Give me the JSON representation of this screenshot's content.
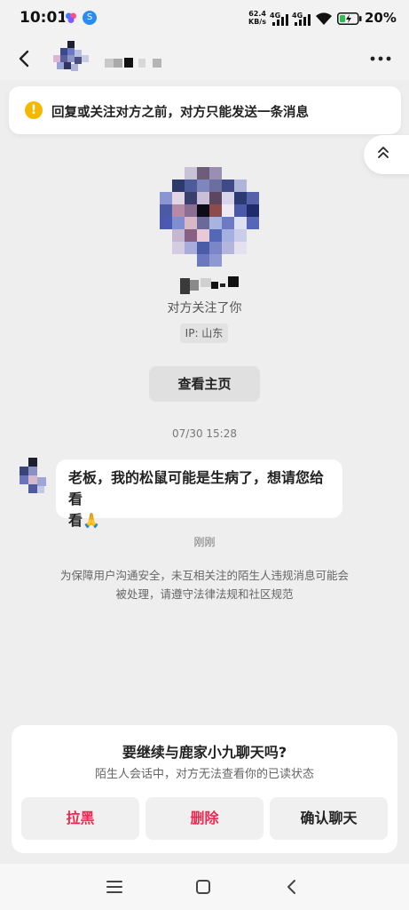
{
  "status_bar": {
    "time": "10:01",
    "net_speed_value": "62.4",
    "net_speed_unit": "KB/s",
    "signal_1": "4G",
    "signal_2": "4G",
    "battery": "20%"
  },
  "notice": {
    "icon": "warning-icon",
    "text": "回复或关注对方之前，对方只能发送一条消息"
  },
  "profile": {
    "follow_status": "对方关注了你",
    "ip_label": "IP: 山东",
    "home_button": "查看主页"
  },
  "conversation": {
    "timestamp": "07/30 15:28",
    "message_line1": "老板，我的松鼠可能是生病了，想请您给看",
    "message_line2": "看🙏",
    "message_time": "刚刚",
    "safety_line1": "为保障用户沟通安全，未互相关注的陌生人违规消息可能会",
    "safety_line2": "被处理，请遵守法律法规和社区规范"
  },
  "prompt_card": {
    "title": "要继续与鹿家小九聊天吗?",
    "subtitle": "陌生人会话中，对方无法查看你的已读状态",
    "block_label": "拉黑",
    "delete_label": "删除",
    "confirm_label": "确认聊天"
  },
  "colors": {
    "accent_red": "#ee2750",
    "warning_yellow": "#f5b800",
    "background": "#eeeeee"
  }
}
